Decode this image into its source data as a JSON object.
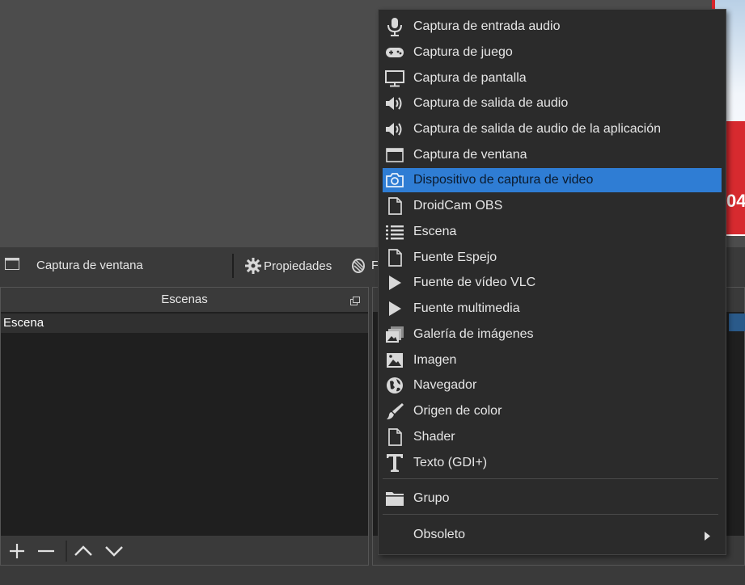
{
  "preview": {
    "strip_text": "04"
  },
  "toolbar": {
    "source_name": "Captura de ventana",
    "properties_label": "Propiedades",
    "filters_label": "F"
  },
  "scenes_dock": {
    "title": "Escenas",
    "items": [
      "Escena"
    ]
  },
  "context_menu": {
    "items": [
      {
        "label": "Captura de entrada audio",
        "icon": "microphone-icon"
      },
      {
        "label": "Captura de juego",
        "icon": "gamepad-icon"
      },
      {
        "label": "Captura de pantalla",
        "icon": "monitor-icon"
      },
      {
        "label": "Captura de salida de audio",
        "icon": "speaker-icon"
      },
      {
        "label": "Captura de salida de audio de la aplicación",
        "icon": "speaker-icon"
      },
      {
        "label": "Captura de ventana",
        "icon": "window-icon"
      },
      {
        "label": "Dispositivo de captura de video",
        "icon": "camera-icon",
        "selected": true
      },
      {
        "label": "DroidCam OBS",
        "icon": "file-icon"
      },
      {
        "label": "Escena",
        "icon": "list-icon"
      },
      {
        "label": "Fuente Espejo",
        "icon": "file-icon"
      },
      {
        "label": "Fuente de vídeo VLC",
        "icon": "play-icon"
      },
      {
        "label": "Fuente multimedia",
        "icon": "play-icon"
      },
      {
        "label": "Galería de imágenes",
        "icon": "gallery-icon"
      },
      {
        "label": "Imagen",
        "icon": "image-icon"
      },
      {
        "label": "Navegador",
        "icon": "globe-icon"
      },
      {
        "label": "Origen de color",
        "icon": "brush-icon"
      },
      {
        "label": "Shader",
        "icon": "file-icon"
      },
      {
        "label": "Texto (GDI+)",
        "icon": "text-icon"
      }
    ],
    "group": {
      "label": "Grupo",
      "icon": "folder-icon"
    },
    "deprecated": {
      "label": "Obsoleto",
      "icon": "chevron-right-icon"
    }
  },
  "colors": {
    "menu_selected": "#2f7dd4",
    "menu_bg": "#2b2b2b",
    "panel_bg": "#1f1f1f",
    "toolbar_bg": "#3a3a3a"
  }
}
